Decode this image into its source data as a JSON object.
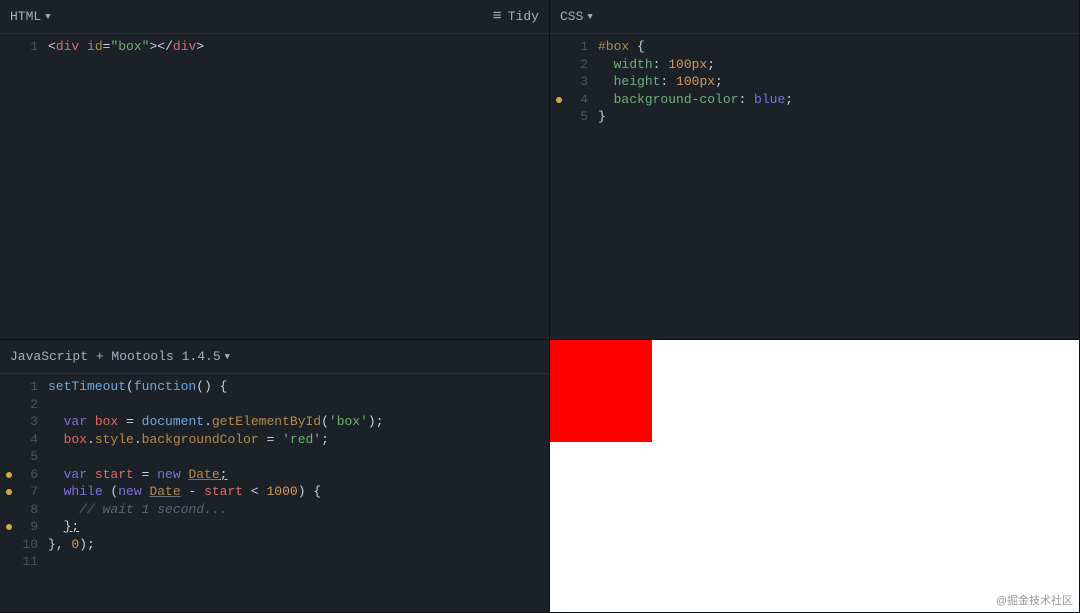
{
  "panes": {
    "html": {
      "title": "HTML",
      "tidy_label": "Tidy"
    },
    "css": {
      "title": "CSS"
    },
    "js": {
      "title": "JavaScript + Mootools 1.4.5"
    }
  },
  "html_code": {
    "lines": [
      "1"
    ],
    "tokens": {
      "lt1": "<",
      "tag_div_o": "div",
      "sp1": " ",
      "attr_id": "id",
      "eq": "=",
      "str_box": "\"box\"",
      "gt1": ">",
      "lt2": "</",
      "tag_div_c": "div",
      "gt2": ">"
    }
  },
  "css_code": {
    "lines": [
      "1",
      "2",
      "3",
      "4",
      "5"
    ],
    "dots": [
      false,
      false,
      false,
      true,
      false
    ],
    "tokens": {
      "sel": "#box",
      "ob": " {",
      "p_width": "width",
      "c": ":",
      "v_100a": " 100px",
      "sc": ";",
      "p_height": "height",
      "v_100b": " 100px",
      "p_bg": "background-color",
      "v_blue": " blue",
      "cb": "}"
    }
  },
  "js_code": {
    "lines": [
      "1",
      "2",
      "3",
      "4",
      "5",
      "6",
      "7",
      "8",
      "9",
      "10",
      "11"
    ],
    "dots": [
      false,
      false,
      false,
      false,
      false,
      true,
      true,
      false,
      true,
      false,
      false
    ],
    "tokens": {
      "fn_setTimeout": "setTimeout",
      "lp": "(",
      "kw_function": "function",
      "rp_lp_ob": "() {",
      "kw_var1": "var",
      "v_box": " box",
      "eq": " = ",
      "obj_document": "document",
      "dot": ".",
      "m_getEl": "getElementById",
      "lp2": "(",
      "s_box": "'box'",
      "rp_sc": ");",
      "v_box2": "box",
      "m_style": "style",
      "m_bgc": "backgroundColor",
      "eq2": " = ",
      "s_red": "'red'",
      "sc": ";",
      "kw_var2": "var",
      "v_start": " start",
      "eq3": " = ",
      "kw_new1": "new",
      "sp": " ",
      "t_Date1": "Date",
      "sc2": ";",
      "kw_while": "while",
      "lp3": " (",
      "kw_new2": "new",
      "sp2": " ",
      "t_Date2": "Date",
      "minus": " - ",
      "v_start2": "start",
      "lt": " < ",
      "n_1000": "1000",
      "rp_ob": ") {",
      "cmt": "// wait 1 second...",
      "cb_sc": "};",
      "cb": "}",
      "comma": ", ",
      "n_0": "0",
      "rp_sc2": ");"
    }
  },
  "preview": {
    "box_color": "#ff0000"
  },
  "watermark": "@掘金技术社区"
}
